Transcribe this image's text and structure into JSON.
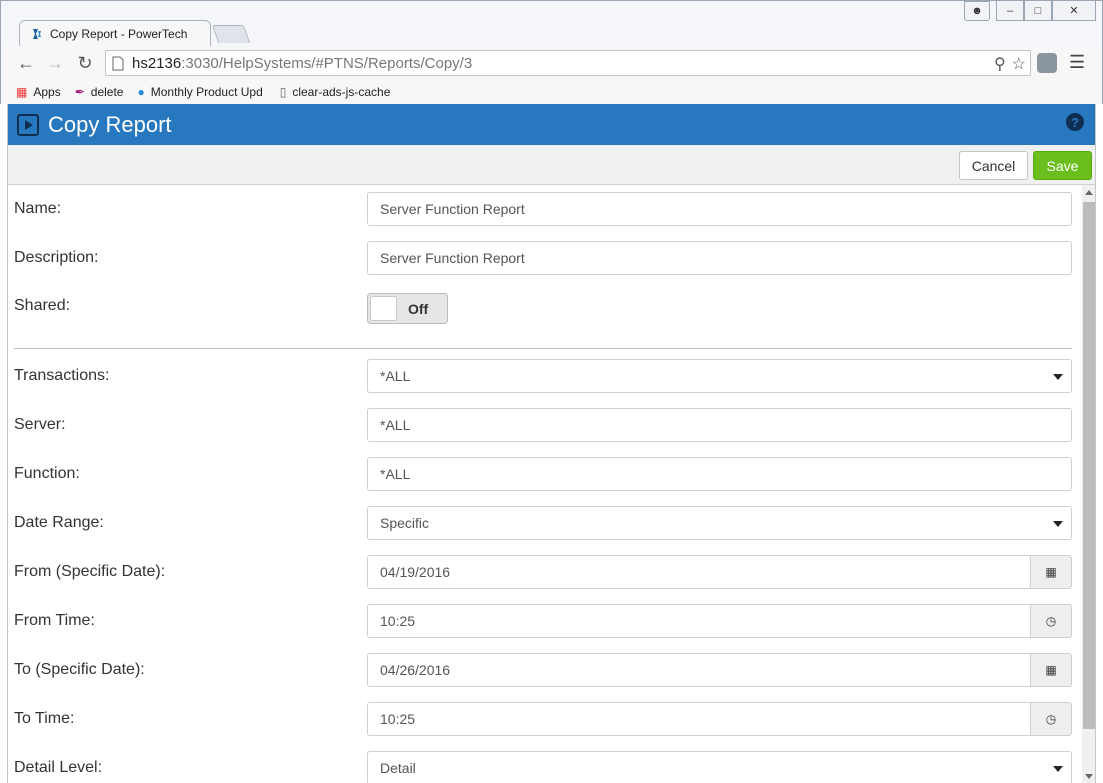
{
  "browser": {
    "tab_title": "Copy Report - PowerTech",
    "url_host": "hs2136",
    "url_path": ":3030/HelpSystems/#PTNS/Reports/Copy/3",
    "bookmarks": [
      "Apps",
      "delete",
      "Monthly Product Upd",
      "clear-ads-js-cache"
    ]
  },
  "header": {
    "title": "Copy Report"
  },
  "actions": {
    "cancel_label": "Cancel",
    "save_label": "Save"
  },
  "form": {
    "name": {
      "label": "Name:",
      "value": "Server Function Report"
    },
    "description": {
      "label": "Description:",
      "value": "Server Function Report"
    },
    "shared": {
      "label": "Shared:",
      "state": "Off"
    },
    "transactions": {
      "label": "Transactions:",
      "value": "*ALL"
    },
    "server": {
      "label": "Server:",
      "value": "*ALL"
    },
    "function": {
      "label": "Function:",
      "value": "*ALL"
    },
    "date_range": {
      "label": "Date Range:",
      "value": "Specific"
    },
    "from_date": {
      "label": "From (Specific Date):",
      "value": "04/19/2016"
    },
    "from_time": {
      "label": "From Time:",
      "value": "10:25"
    },
    "to_date": {
      "label": "To (Specific Date):",
      "value": "04/26/2016"
    },
    "to_time": {
      "label": "To Time:",
      "value": "10:25"
    },
    "detail_level": {
      "label": "Detail Level:",
      "value": "Detail"
    }
  },
  "colors": {
    "header_blue": "#2778bf",
    "save_green": "#6bbf1c"
  }
}
